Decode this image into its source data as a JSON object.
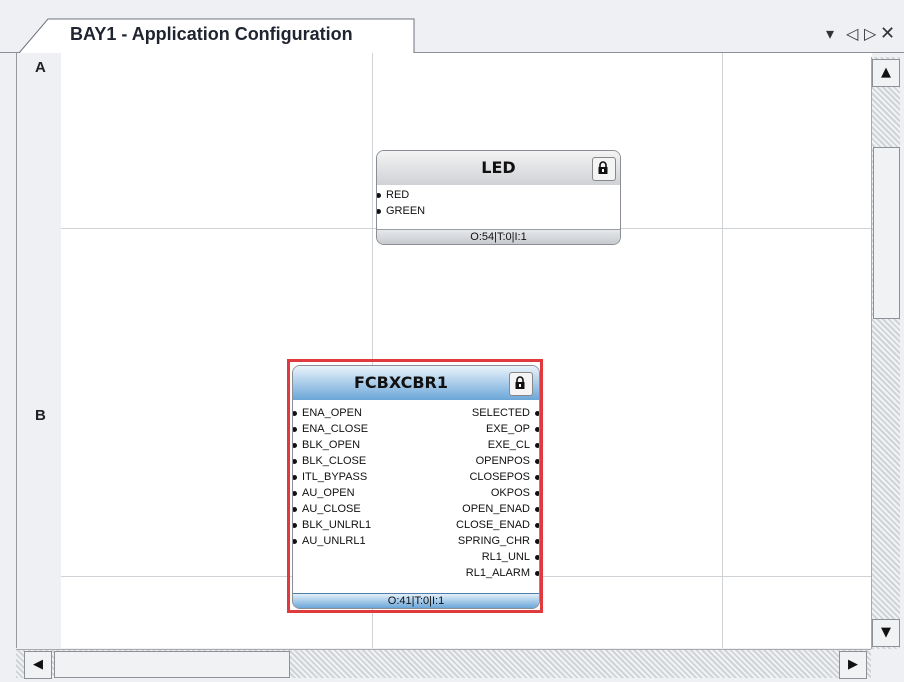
{
  "tab": {
    "title": "BAY1 - Application Configuration"
  },
  "window_buttons": {
    "dropdown": "▾",
    "prev": "◁",
    "next": "▷",
    "close": "✕"
  },
  "rows": [
    "A",
    "B"
  ],
  "blocks": {
    "led": {
      "name": "LED",
      "inputs": [
        "RED",
        "GREEN"
      ],
      "footer": "O:54|T:0|I:1"
    },
    "fcbxcbr1": {
      "name": "FCBXCBR1",
      "inputs": [
        "ENA_OPEN",
        "ENA_CLOSE",
        "BLK_OPEN",
        "BLK_CLOSE",
        "ITL_BYPASS",
        "AU_OPEN",
        "AU_CLOSE",
        "BLK_UNLRL1",
        "AU_UNLRL1"
      ],
      "outputs": [
        "SELECTED",
        "EXE_OP",
        "EXE_CL",
        "OPENPOS",
        "CLOSEPOS",
        "OKPOS",
        "OPEN_ENAD",
        "CLOSE_ENAD",
        "SPRING_CHR",
        "RL1_UNL",
        "RL1_ALARM"
      ],
      "footer": "O:41|T:0|I:1",
      "selected": true
    }
  },
  "scrollbars": {
    "up": "▲",
    "down": "▼",
    "left": "◀",
    "right": "▶"
  },
  "colors": {
    "selection": "#e03a3e",
    "fcb_header": "#6aa6d8",
    "grid": "#cfd3d8"
  }
}
